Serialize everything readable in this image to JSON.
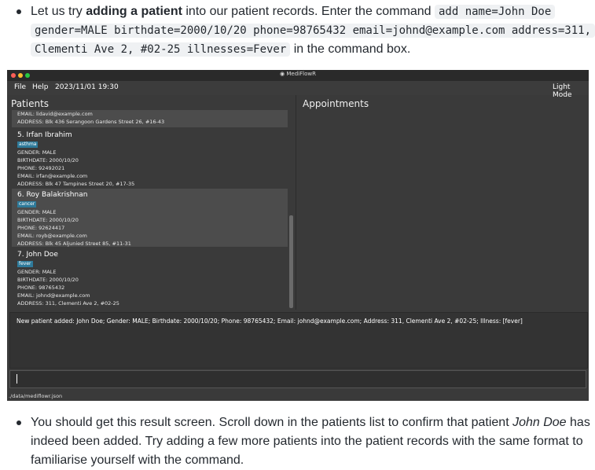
{
  "intro": {
    "prefix": "Let us try ",
    "bold": "adding a patient",
    "middle": " into our patient records. Enter the command ",
    "code_line1": "add name=John Doe",
    "code_line2": "gender=MALE birthdate=2000/10/20 phone=98765432 email=johnd@example.com address=311,",
    "code_line3": "Clementi Ave 2, #02-25 illnesses=Fever",
    "suffix": " in the command box."
  },
  "app": {
    "title": "MediFlowR",
    "menu": {
      "file": "File",
      "help": "Help",
      "datetime": "2023/11/01 19:30",
      "mode": "Light Mode"
    },
    "patients_title": "Patients",
    "appointments_title": "Appointments",
    "partial_card": {
      "email": "EMAIL: lidavid@example.com",
      "address": "ADDRESS: Blk 436 Serangoon Gardens Street 26, #16-43"
    },
    "patients": [
      {
        "name": "5.  Irfan Ibrahim",
        "tag": "asthma",
        "gender": "GENDER: MALE",
        "birthdate": "BIRTHDATE: 2000/10/20",
        "phone": "PHONE: 92492021",
        "email": "EMAIL: irfan@example.com",
        "address": "ADDRESS: Blk 47 Tampines Street 20, #17-35"
      },
      {
        "name": "6.  Roy Balakrishnan",
        "tag": "cancer",
        "gender": "GENDER: MALE",
        "birthdate": "BIRTHDATE: 2000/10/20",
        "phone": "PHONE: 92624417",
        "email": "EMAIL: royb@example.com",
        "address": "ADDRESS: Blk 45 Aljunied Street 85, #11-31"
      },
      {
        "name": "7.  John Doe",
        "tag": "fever",
        "gender": "GENDER: MALE",
        "birthdate": "BIRTHDATE: 2000/10/20",
        "phone": "PHONE: 98765432",
        "email": "EMAIL: johnd@example.com",
        "address": "ADDRESS: 311, Clementi Ave 2, #02-25"
      }
    ],
    "result": "New patient added: John Doe; Gender: MALE; Birthdate: 2000/10/20; Phone: 98765432; Email: johnd@example.com; Address: 311, Clementi Ave 2, #02-25; Illness: [fever]",
    "status": "./data/mediflowr.json"
  },
  "outro": {
    "line1_prefix": "You should get this result screen. Scroll down in the patients list to confirm that patient ",
    "name_italic": "John Doe",
    "line1_suffix": " has",
    "line2": "indeed been added. Try adding a few more patients into the patient records with the same format to",
    "line3": "familiarise yourself with the command."
  },
  "colors": {
    "window_bg": "#3a3a3a",
    "tag_bg": "#2e7a9a",
    "selected_card": "#4c4c4c"
  }
}
